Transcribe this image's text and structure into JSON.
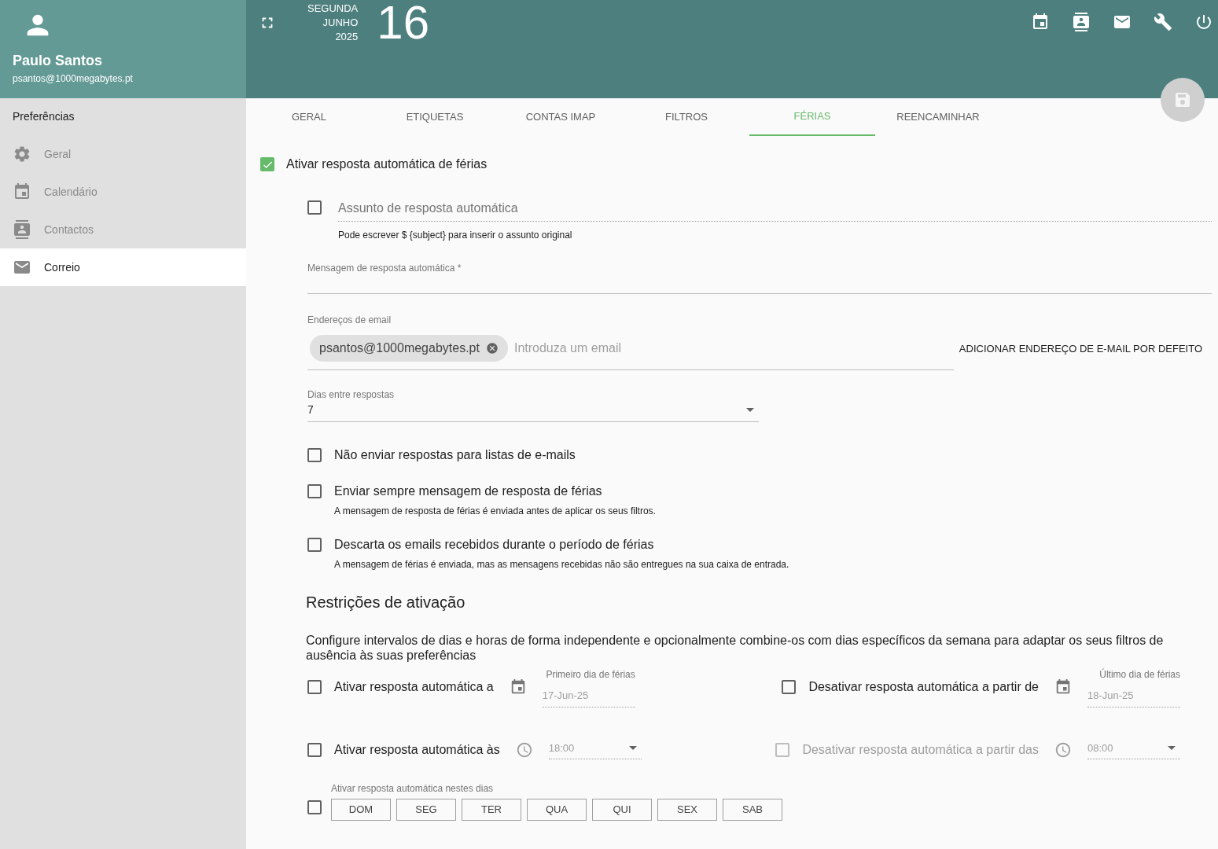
{
  "user": {
    "name": "Paulo Santos",
    "email": "psantos@1000megabytes.pt"
  },
  "header": {
    "weekday": "SEGUNDA",
    "month": "JUNHO",
    "year": "2025",
    "day": "16"
  },
  "sidebar": {
    "title": "Preferências",
    "items": [
      {
        "label": "Geral",
        "kind": "settings",
        "selected": false
      },
      {
        "label": "Calendário",
        "kind": "calendar",
        "selected": false
      },
      {
        "label": "Contactos",
        "kind": "contacts",
        "selected": false
      },
      {
        "label": "Correio",
        "kind": "mail",
        "selected": true
      }
    ]
  },
  "tabs": [
    {
      "label": "GERAL",
      "selected": false
    },
    {
      "label": "ETIQUETAS",
      "selected": false
    },
    {
      "label": "CONTAS IMAP",
      "selected": false
    },
    {
      "label": "FILTROS",
      "selected": false
    },
    {
      "label": "FÉRIAS",
      "selected": true
    },
    {
      "label": "REENCAMINHAR",
      "selected": false
    }
  ],
  "enable": {
    "label": "Ativar resposta automática de férias",
    "checked": true
  },
  "subject": {
    "checked": false,
    "placeholder": "Assunto de resposta automática",
    "hint": "Pode escrever $ {subject} para inserir o assunto original"
  },
  "message": {
    "label": "Mensagem de resposta automática *"
  },
  "addresses": {
    "label": "Endereços de email",
    "chips": [
      "psantos@1000megabytes.pt"
    ],
    "placeholder": "Introduza um email",
    "add_default_button": "ADICIONAR ENDEREÇO DE E-MAIL POR DEFEITO"
  },
  "days_between": {
    "label": "Dias entre respostas",
    "value": "7"
  },
  "options": [
    {
      "label": "Não enviar respostas para listas de e-mails",
      "checked": false
    },
    {
      "label": "Enviar sempre mensagem de resposta de férias",
      "hint": "A mensagem de resposta de férias é enviada antes de aplicar os seus filtros.",
      "checked": false
    },
    {
      "label": "Descarta os emails recebidos durante o período de férias",
      "hint": "A mensagem de férias é enviada, mas as mensagens recebidas não são entregues na sua caixa de entrada.",
      "checked": false
    }
  ],
  "restrictions": {
    "title": "Restrições de ativação",
    "description": "Configure intervalos de dias e horas de forma independente e opcionalmente combine-os com dias específicos da semana para adaptar os seus filtros de ausência às suas preferências",
    "start_date": {
      "label": "Ativar resposta automática a",
      "field_label": "Primeiro dia de férias",
      "value": "17-Jun-25",
      "checked": false
    },
    "end_date": {
      "label": "Desativar resposta automática a partir de",
      "field_label": "Último dia de férias",
      "value": "18-Jun-25",
      "checked": false
    },
    "start_time": {
      "label": "Ativar resposta automática às",
      "value": "18:00",
      "checked": false,
      "disabled": false
    },
    "end_time": {
      "label": "Desativar resposta automática a partir das",
      "value": "08:00",
      "checked": false,
      "disabled": true
    },
    "weekdays": {
      "label": "Ativar resposta automática nestes dias",
      "checked": false,
      "days": [
        {
          "label": "DOM",
          "selected": false
        },
        {
          "label": "SEG",
          "selected": false
        },
        {
          "label": "TER",
          "selected": false
        },
        {
          "label": "QUA",
          "selected": false
        },
        {
          "label": "QUI",
          "selected": false
        },
        {
          "label": "SEX",
          "selected": false
        },
        {
          "label": "SAB",
          "selected": false
        }
      ]
    }
  }
}
